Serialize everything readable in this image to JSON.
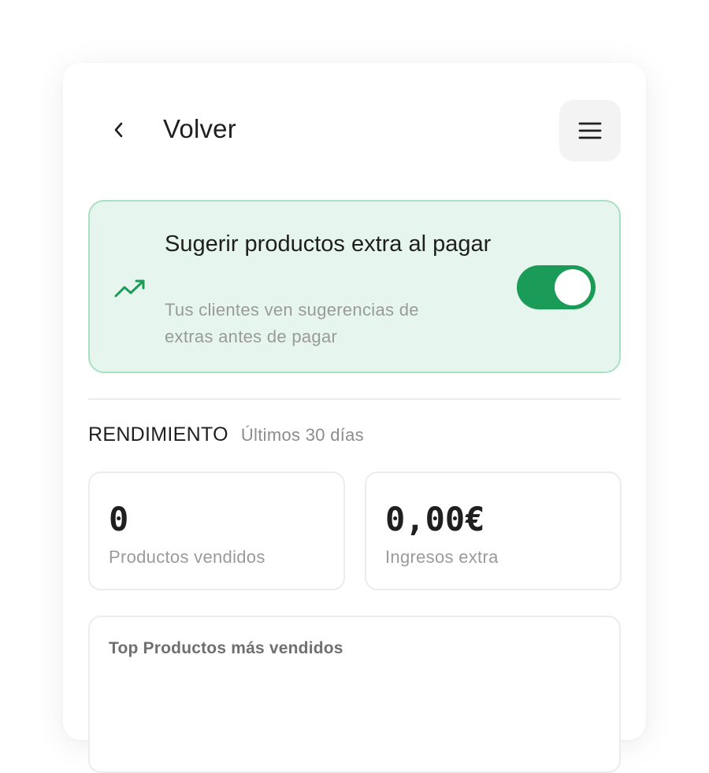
{
  "header": {
    "back_label": "Volver",
    "back_icon": "chevron-left-icon",
    "menu_icon": "hamburger-menu-icon"
  },
  "upsell": {
    "title": "Sugerir productos extra al pagar",
    "subtitle": "Tus clientes ven sugerencias de extras antes de pagar",
    "icon": "trending-up-icon",
    "enabled": true,
    "accent_color": "#1a9b57",
    "background_color": "#e6f6ee",
    "border_color": "#a9e0c4"
  },
  "performance": {
    "label": "RENDIMIENTO",
    "period": "Últimos 30 días",
    "stats": [
      {
        "value": "0",
        "label": "Productos vendidos"
      },
      {
        "value": "0,00€",
        "label": "Ingresos extra"
      }
    ]
  },
  "top_products": {
    "title": "Top Productos más vendidos"
  }
}
